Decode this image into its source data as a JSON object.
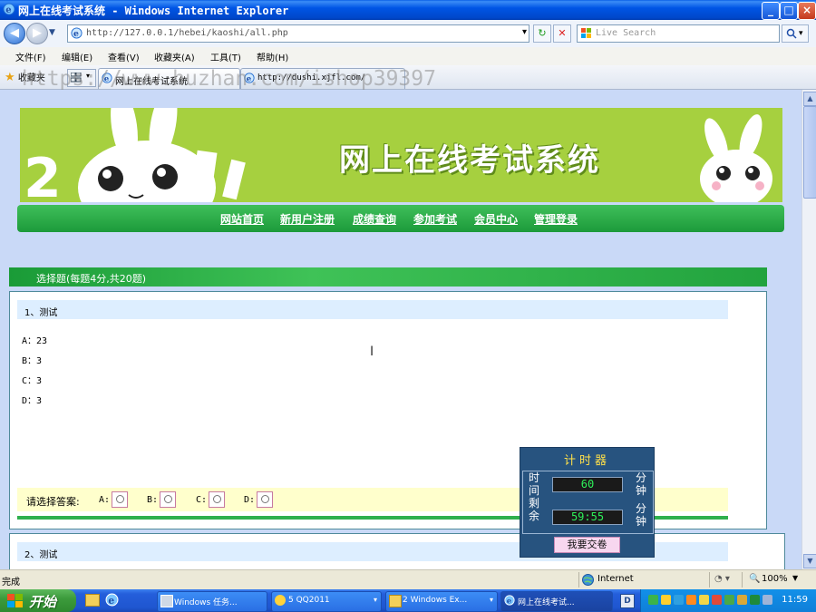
{
  "window": {
    "title": "网上在线考试系统 - Windows Internet Explorer",
    "minimize_label": "_",
    "maximize_label": "□",
    "close_label": "×"
  },
  "addressbar": {
    "url": "http://127.0.0.1/hebei/kaoshi/all.php",
    "search_placeholder": "Live Search",
    "search_icon": "magnifier-icon",
    "refresh_label": "↻",
    "stop_label": "✕",
    "dropdown_label": "▾"
  },
  "menu": {
    "items": [
      {
        "label": "文件(F)"
      },
      {
        "label": "编辑(E)"
      },
      {
        "label": "查看(V)"
      },
      {
        "label": "收藏夹(A)"
      },
      {
        "label": "工具(T)"
      },
      {
        "label": "帮助(H)"
      }
    ]
  },
  "tabs": {
    "favorites_label": "收藏夹",
    "items": [
      {
        "label": "网上在线考试系统"
      },
      {
        "label": "http://dushi.xjfl.com/"
      }
    ]
  },
  "watermark": "https://www.huzhan.com/ishop39397",
  "site": {
    "title": "网上在线考试系统",
    "nav": [
      {
        "label": "网站首页"
      },
      {
        "label": "新用户注册"
      },
      {
        "label": "成绩查询"
      },
      {
        "label": "参加考试"
      },
      {
        "label": "会员中心"
      },
      {
        "label": "管理登录"
      }
    ]
  },
  "exam": {
    "section_title": "选择题(每题4分,共20题)",
    "questions": [
      {
        "title": "1、测试",
        "options": [
          "A：23",
          "B：3",
          "C：3",
          "D：3"
        ]
      },
      {
        "title": "2、测试"
      }
    ],
    "answer_prompt": "请选择答案:",
    "answer_choices": [
      "A:",
      "B:",
      "C:",
      "D:"
    ]
  },
  "timer": {
    "title": "计时器",
    "left_label": "时间剩余",
    "total_minutes": "60",
    "remaining": "59:55",
    "unit": "分钟",
    "submit_label": "我要交卷"
  },
  "statusbar": {
    "status": "完成",
    "zone": "Internet",
    "zoom": "100%"
  },
  "taskbar": {
    "start_label": "开始",
    "tasks": [
      {
        "label": "Windows 任务..."
      },
      {
        "label": "5 QQ2011"
      },
      {
        "label": "2 Windows Ex..."
      },
      {
        "label": "网上在线考试..."
      }
    ],
    "clock": "11:59"
  },
  "colors": {
    "banner_green": "#a6d03f",
    "nav_green": "#1c9a3a",
    "page_bg": "#c9d9f7",
    "timer_bg": "#27537f",
    "lcd_green": "#2ef15a"
  }
}
